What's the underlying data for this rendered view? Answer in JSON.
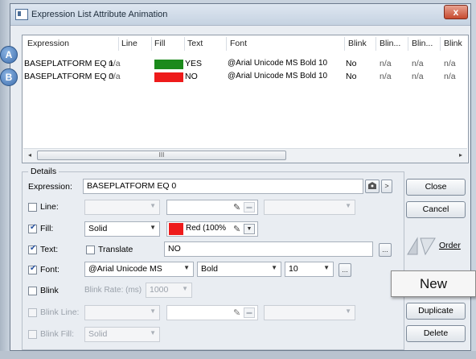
{
  "window": {
    "title": "Expression List Attribute Animation",
    "close_glyph": "x"
  },
  "list": {
    "columns": [
      "Expression",
      "Line",
      "Fill",
      "Text",
      "Font",
      "Blink",
      "Blin...",
      "Blin...",
      "Blink"
    ],
    "rows": [
      {
        "badge": "A",
        "expression": "BASEPLATFORM EQ 1",
        "line": "n/a",
        "fill_color": "#1b8a1b",
        "text": "YES",
        "font": "@Arial Unicode MS  Bold  10",
        "blink": "No",
        "blink2": "n/a",
        "blink3": "n/a",
        "blink4": "n/a"
      },
      {
        "badge": "B",
        "expression": "BASEPLATFORM EQ 0",
        "line": "n/a",
        "fill_color": "#ee1b1b",
        "text": "NO",
        "font": "@Arial Unicode MS  Bold  10",
        "blink": "No",
        "blink2": "n/a",
        "blink3": "n/a",
        "blink4": "n/a"
      }
    ],
    "scroll_left": "◂",
    "scroll_right": "▸",
    "scroll_grip": "III"
  },
  "details": {
    "group_label": "Details",
    "expression_label": "Expression:",
    "expression_value": "BASEPLATFORM EQ 0",
    "line": {
      "label": "Line:",
      "checked": false
    },
    "fill": {
      "label": "Fill:",
      "checked": true,
      "style": "Solid",
      "color_label": "Red (100%",
      "color": "#ee1b1b"
    },
    "text": {
      "label": "Text:",
      "checked": true,
      "translate_label": "Translate",
      "translate_checked": false,
      "value": "NO",
      "more_glyph": "..."
    },
    "font": {
      "label": "Font:",
      "checked": true,
      "family": "@Arial Unicode MS",
      "style": "Bold",
      "size": "10",
      "more_glyph": "..."
    },
    "blink": {
      "label": "Blink",
      "checked": false,
      "rate_label": "Blink Rate: (ms)",
      "rate_value": "1000"
    },
    "blink_line": {
      "label": "Blink Line:",
      "checked": false
    },
    "blink_fill": {
      "label": "Blink Fill:",
      "checked": false,
      "style": "Solid"
    }
  },
  "buttons": {
    "close": "Close",
    "cancel": "Cancel",
    "order": "Order",
    "new": "New",
    "duplicate": "Duplicate",
    "delete": "Delete",
    "arrow_glyph": ">"
  },
  "icons": {
    "app": "window-icon",
    "tag": "tag-icon",
    "pipette": "eyedropper-icon",
    "order": "order-arrows-icon"
  }
}
